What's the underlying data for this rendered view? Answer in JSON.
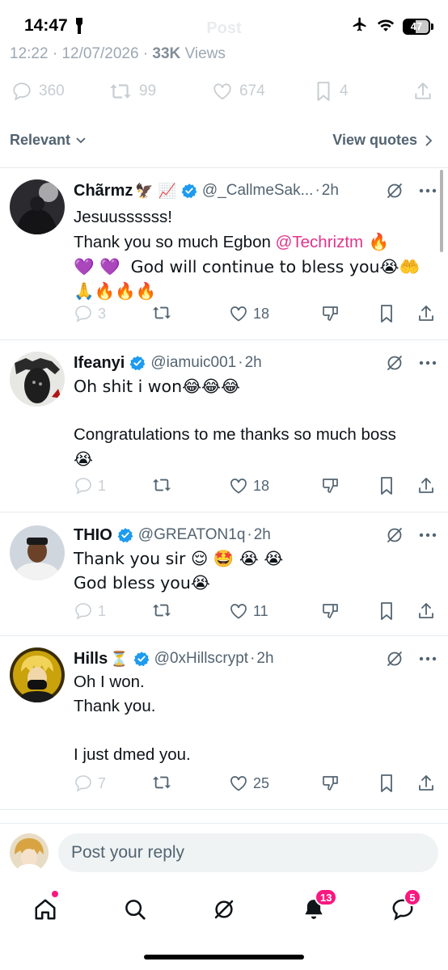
{
  "status_bar": {
    "time": "14:47",
    "battery": "47"
  },
  "header": {
    "title": "Post"
  },
  "post_meta": {
    "time": "12:22",
    "date": "12/07/2026",
    "views_count": "33K",
    "views_label": "Views",
    "replies": "360",
    "reposts": "99",
    "likes": "674",
    "bookmarks": "4"
  },
  "sort_bar": {
    "sort_label": "Relevant",
    "quotes_label": "View quotes"
  },
  "replies": [
    {
      "name": "Chãrmz",
      "name_emoji": "🦅 📈",
      "handle": "@_CallmeSak...",
      "time": "2h",
      "line1": "Jesuussssss!",
      "line2_pre": "Thank you so much Egbon ",
      "mention": "@Techriztm",
      "line2_post": " 🔥",
      "line3": "💜 💜  God will continue to bless you😭🤲",
      "line4": "🙏🔥🔥🔥",
      "reply_count": "3",
      "like_count": "18"
    },
    {
      "name": "Ifeanyi",
      "handle": "@iamuic001",
      "time": "2h",
      "line1": "Oh shit i won😂😂😂",
      "line2": "",
      "line3": "Congratulations to me thanks so much boss",
      "line4": "😭",
      "reply_count": "1",
      "like_count": "18"
    },
    {
      "name": "THIO",
      "handle": "@GREATON1q",
      "time": "2h",
      "line1": "Thank you sir 😌 🤩 😭 😭",
      "line2": "God bless you😭",
      "reply_count": "1",
      "like_count": "11"
    },
    {
      "name": "Hills",
      "name_emoji": "⏳",
      "handle": "@0xHillscrypt",
      "time": "2h",
      "line1": "Oh I won.",
      "line2": "Thank you.",
      "line3": "",
      "line4": "I just dmed you.",
      "reply_count": "7",
      "like_count": "25"
    }
  ],
  "composer": {
    "placeholder": "Post your reply"
  },
  "tab_bar": {
    "notifications_badge": "13",
    "messages_badge": "5"
  },
  "colors": {
    "verified": "#1d9bf0",
    "mention": "#e2338a",
    "badge": "#f91880",
    "secondary_text": "#536471"
  }
}
